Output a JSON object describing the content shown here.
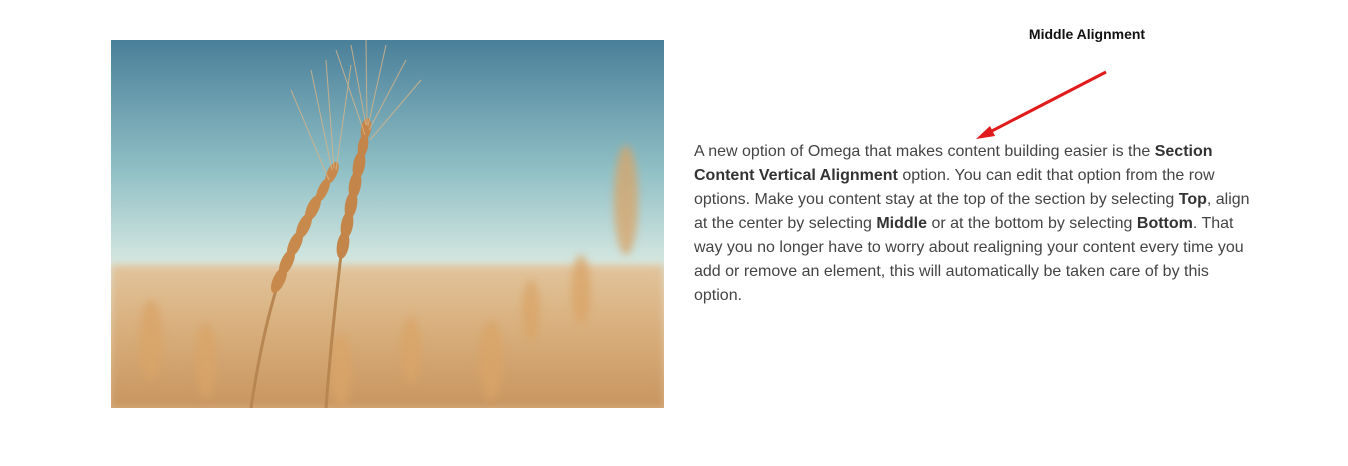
{
  "annotation": {
    "label": "Middle Alignment",
    "arrow_color": "#e11b1b"
  },
  "image": {
    "icon": "wheat-field-photo"
  },
  "content": {
    "t1": "A new option of Omega that makes content building easier is the ",
    "b1": "Section Content Vertical Alignment",
    "t2": " option. You can edit that option from the row options. Make you content stay at the top of the section by selecting ",
    "b2": "Top",
    "t3": ", align at the center by selecting ",
    "b3": "Middle",
    "t4": " or at the bottom by selecting ",
    "b4": "Bottom",
    "t5": ". That way you no longer have to worry about realigning your content every time you add or remove an element, this will automatically be taken care of by this option."
  },
  "colors": {
    "text": "#444444",
    "sky_top": "#4e86a0",
    "sky_bottom": "#cfe3e0",
    "field": "#d7b083"
  }
}
